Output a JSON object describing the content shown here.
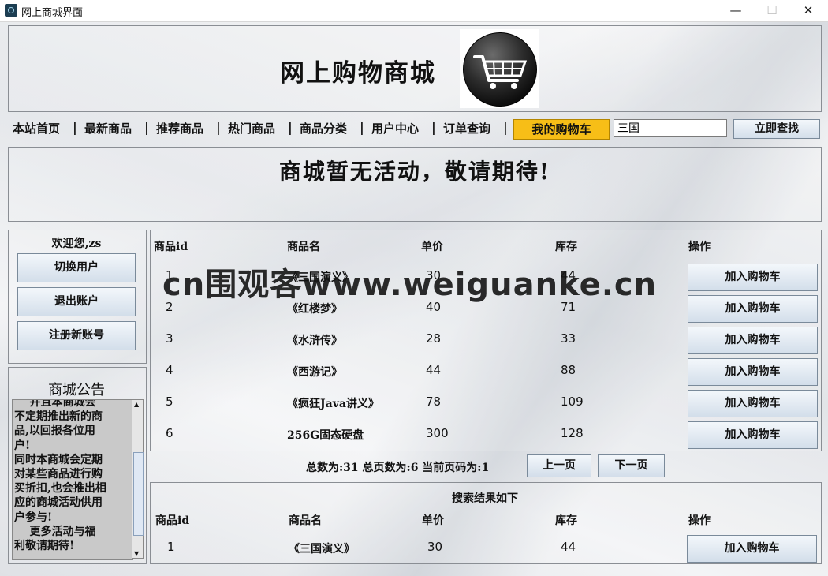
{
  "window": {
    "title": "网上商城界面",
    "minimize": "—",
    "maximize": "☐",
    "close": "✕"
  },
  "header": {
    "site_title": "网上购物商城",
    "logo_icon": "shopping-cart-icon"
  },
  "nav": {
    "items": [
      "本站首页",
      "最新商品",
      "推荐商品",
      "热门商品",
      "商品分类",
      "用户中心",
      "订单查询"
    ],
    "cart_label": "我的购物车",
    "search_value": "三国",
    "search_button": "立即查找"
  },
  "promo": {
    "text": "商城暂无活动，敬请期待!"
  },
  "user": {
    "welcome": "欢迎您,zs",
    "switch_user": "切换用户",
    "logout": "退出账户",
    "register": "注册新账号"
  },
  "notice": {
    "title": "商城公告",
    "text": "    并且本商城会\n不定期推出新的商\n品,以回报各位用\n户!\n同时本商城会定期\n对某些商品进行购\n买折扣,也会推出相\n应的商城活动供用\n户参与!\n    更多活动与福\n利敬请期待!"
  },
  "products": {
    "columns": [
      "商品id",
      "商品名",
      "单价",
      "库存",
      "操作"
    ],
    "rows": [
      {
        "id": "1",
        "name": "《三国演义》",
        "price": "30",
        "stock": "44",
        "action": "加入购物车"
      },
      {
        "id": "2",
        "name": "《红楼梦》",
        "price": "40",
        "stock": "71",
        "action": "加入购物车"
      },
      {
        "id": "3",
        "name": "《水浒传》",
        "price": "28",
        "stock": "33",
        "action": "加入购物车"
      },
      {
        "id": "4",
        "name": "《西游记》",
        "price": "44",
        "stock": "88",
        "action": "加入购物车"
      },
      {
        "id": "5",
        "name": "《疯狂Java讲义》",
        "price": "78",
        "stock": "109",
        "action": "加入购物车"
      },
      {
        "id": "6",
        "name": "256G固态硬盘",
        "price": "300",
        "stock": "128",
        "action": "加入购物车"
      }
    ]
  },
  "pager": {
    "text": "总数为:31 总页数为:6 当前页码为:1",
    "prev": "上一页",
    "next": "下一页"
  },
  "results": {
    "title": "搜索结果如下",
    "columns": [
      "商品id",
      "商品名",
      "单价",
      "库存",
      "操作"
    ],
    "rows": [
      {
        "id": "1",
        "name": "《三国演义》",
        "price": "30",
        "stock": "44",
        "action": "加入购物车"
      }
    ]
  },
  "watermark": "cn围观客www.weiguanke.cn"
}
